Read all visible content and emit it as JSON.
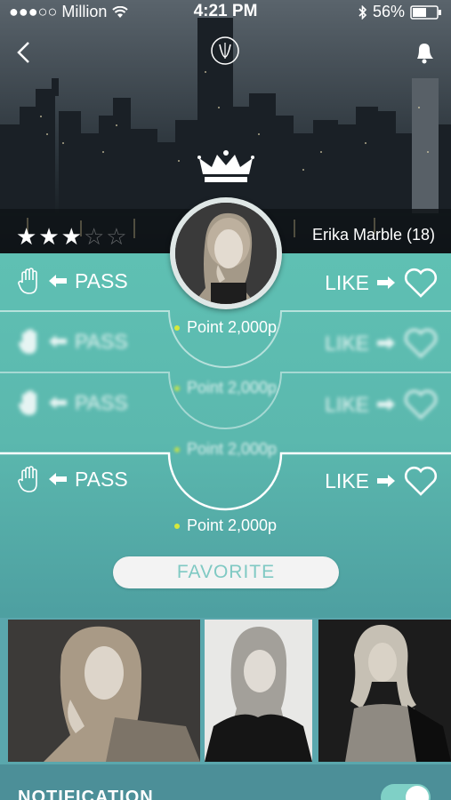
{
  "statusbar": {
    "carrier": "●●●○○ Million",
    "time": "4:21 PM",
    "battery": "56%"
  },
  "nav": {
    "logo_text": "Ⓥ"
  },
  "profile": {
    "name": "Erika Marble (18)",
    "rating": 3,
    "max_rating": 5
  },
  "rows": [
    {
      "pass_label": "PASS",
      "like_label": "LIKE",
      "point_text": "Point 2,000p"
    },
    {
      "pass_label": "PASS",
      "like_label": "LIKE",
      "point_text": "Point 2,000p"
    },
    {
      "pass_label": "PASS",
      "like_label": "LIKE",
      "point_text": "Point 2,000p"
    },
    {
      "pass_label": "PASS",
      "like_label": "LIKE",
      "point_text": "Point 2,000p"
    }
  ],
  "favorite_button": {
    "label": "FAVORITE"
  },
  "gallery": {
    "count": 3
  },
  "notification": {
    "label": "NOTIFICATION",
    "enabled": true
  },
  "colors": {
    "accent": "#5fc0b3",
    "favorite_text": "#7fc9c3",
    "point_dot": "#d6e83a"
  }
}
